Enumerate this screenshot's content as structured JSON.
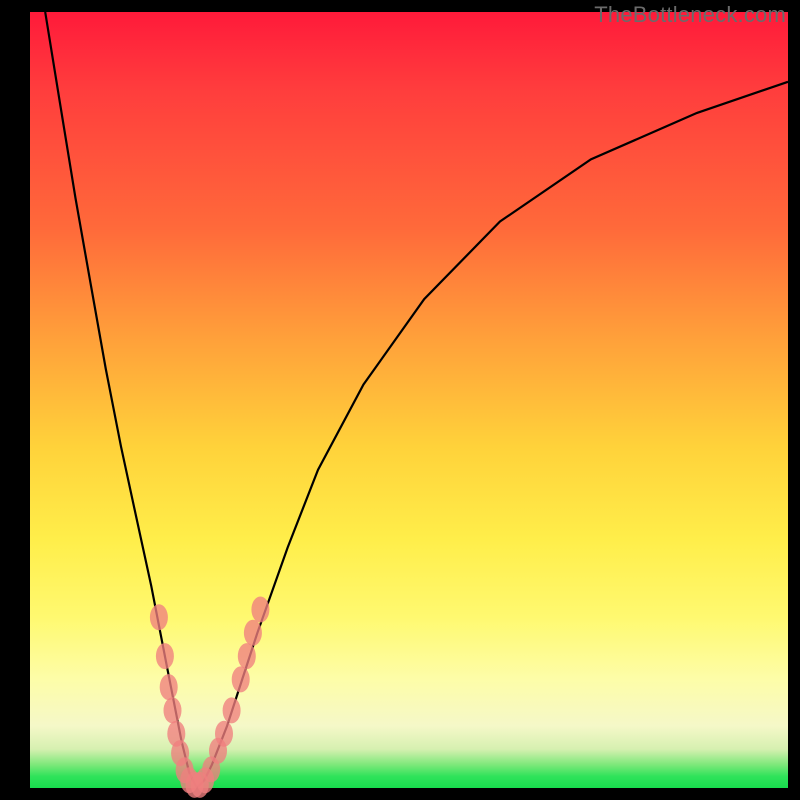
{
  "watermark": "TheBottleneck.com",
  "colors": {
    "frame": "#000000",
    "marker": "#ef7f7f",
    "curve": "#000000",
    "gradient_top": "#ff1a3a",
    "gradient_bottom": "#18dc4e"
  },
  "chart_data": {
    "type": "line",
    "title": "",
    "xlabel": "",
    "ylabel": "",
    "xlim": [
      0,
      100
    ],
    "ylim": [
      0,
      100
    ],
    "series": [
      {
        "name": "bottleneck-curve",
        "x": [
          2,
          4,
          6,
          8,
          10,
          12,
          14,
          16,
          18,
          19,
          20,
          21,
          22,
          23,
          24,
          26,
          28,
          30,
          34,
          38,
          44,
          52,
          62,
          74,
          88,
          100
        ],
        "y": [
          100,
          88,
          76,
          65,
          54,
          44,
          35,
          26,
          16,
          11,
          6,
          2,
          0,
          1,
          3,
          8,
          14,
          20,
          31,
          41,
          52,
          63,
          73,
          81,
          87,
          91
        ]
      }
    ],
    "markers": {
      "name": "highlighted-points",
      "points": [
        {
          "x": 17.0,
          "y": 22
        },
        {
          "x": 17.8,
          "y": 17
        },
        {
          "x": 18.3,
          "y": 13
        },
        {
          "x": 18.8,
          "y": 10
        },
        {
          "x": 19.3,
          "y": 7
        },
        {
          "x": 19.8,
          "y": 4.5
        },
        {
          "x": 20.4,
          "y": 2.3
        },
        {
          "x": 21.0,
          "y": 1.0
        },
        {
          "x": 21.7,
          "y": 0.4
        },
        {
          "x": 22.4,
          "y": 0.4
        },
        {
          "x": 23.1,
          "y": 1.0
        },
        {
          "x": 23.9,
          "y": 2.4
        },
        {
          "x": 24.8,
          "y": 4.8
        },
        {
          "x": 25.6,
          "y": 7.0
        },
        {
          "x": 26.6,
          "y": 10.0
        },
        {
          "x": 27.8,
          "y": 14.0
        },
        {
          "x": 28.6,
          "y": 17.0
        },
        {
          "x": 29.4,
          "y": 20.0
        },
        {
          "x": 30.4,
          "y": 23.0
        }
      ]
    }
  }
}
